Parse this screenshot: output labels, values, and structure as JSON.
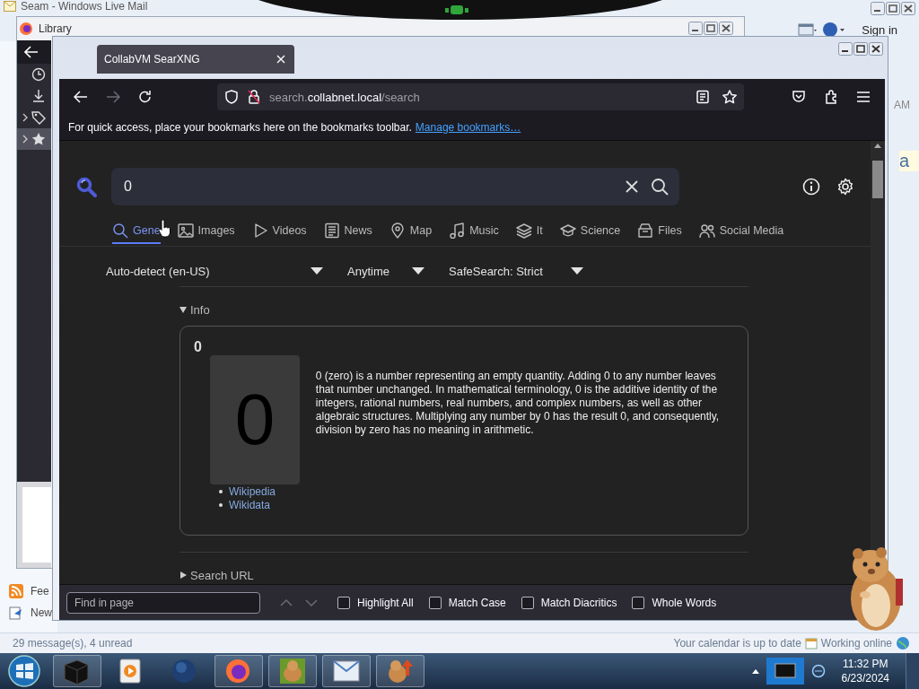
{
  "mail_window": {
    "title": "Seam - Windows Live Mail",
    "sign_in": "Sign in",
    "time_fragment": "AM",
    "preview_fragment": "a",
    "folders": [
      {
        "label": "Fee",
        "kind": "feed"
      },
      {
        "label": "New",
        "kind": "new"
      }
    ],
    "status": {
      "messages": "29 message(s), 4 unread",
      "calendar": "Your calendar is up to date",
      "connection": "Working online"
    }
  },
  "library_window": {
    "title": "Library"
  },
  "browser": {
    "tab": {
      "title": "CollabVM SearXNG"
    },
    "url": {
      "subdomain": "search.",
      "domain": "collabnet.local",
      "path": "/search"
    },
    "bookmarks_bar": {
      "hint": "For quick access, place your bookmarks here on the bookmarks toolbar.",
      "link": "Manage bookmarks…"
    },
    "search": {
      "query": "0"
    },
    "categories": [
      {
        "label": "Gene",
        "kind": "search",
        "selected": true
      },
      {
        "label": "Images",
        "kind": "image",
        "selected": false
      },
      {
        "label": "Videos",
        "kind": "video",
        "selected": false
      },
      {
        "label": "News",
        "kind": "news",
        "selected": false
      },
      {
        "label": "Map",
        "kind": "map",
        "selected": false
      },
      {
        "label": "Music",
        "kind": "music",
        "selected": false
      },
      {
        "label": "It",
        "kind": "it",
        "selected": false
      },
      {
        "label": "Science",
        "kind": "science",
        "selected": false
      },
      {
        "label": "Files",
        "kind": "files",
        "selected": false
      },
      {
        "label": "Social Media",
        "kind": "social",
        "selected": false
      }
    ],
    "filters": [
      "Auto-detect (en-US)",
      "Anytime",
      "SafeSearch: Strict"
    ],
    "infobox": {
      "section": "Info",
      "expanded": true,
      "title": "0",
      "image_text": "0",
      "description": "0 (zero) is a number representing an empty quantity. Adding 0 to any number leaves that number unchanged. In mathematical terminology, 0 is the additive identity of the integers, rational numbers, real numbers, and complex numbers, as well as other algebraic structures. Multiplying any number by 0 has the result 0, and consequently, division by zero has no meaning in arithmetic.",
      "links": [
        "Wikipedia",
        "Wikidata"
      ]
    },
    "search_url": {
      "label": "Search URL",
      "expanded": false
    },
    "find_bar": {
      "placeholder": "Find in page",
      "options": [
        {
          "label": "Highlight All",
          "checked": false
        },
        {
          "label": "Match Case",
          "checked": false
        },
        {
          "label": "Match Diacritics",
          "checked": false
        },
        {
          "label": "Whole Words",
          "checked": false
        }
      ]
    }
  },
  "taskbar": {
    "time": "11:32 PM",
    "date": "6/23/2024"
  }
}
